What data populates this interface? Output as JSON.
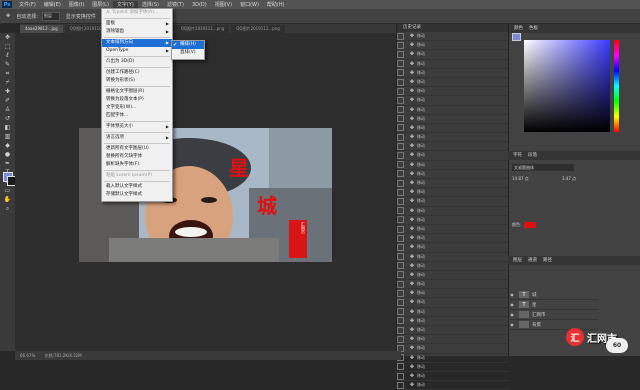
{
  "app": {
    "logo": "Ps"
  },
  "menubar": {
    "items": [
      "文件(F)",
      "编辑(E)",
      "图像(I)",
      "图层(L)",
      "文字(Y)",
      "选择(S)",
      "滤镜(T)",
      "3D(D)",
      "视图(V)",
      "窗口(W)",
      "帮助(H)"
    ],
    "active_index": 4
  },
  "options": {
    "auto_select_label": "自动选择:",
    "auto_select_value": "图层",
    "transform_label": "显示变换控件"
  },
  "tabs": [
    "4aae29812...jpg",
    "QQ图片2019110...png",
    "QQ图片2019112...png",
    "QQ图片2019111...png",
    "QQ图片2019112...png"
  ],
  "type_menu": {
    "items": [
      {
        "label": "从 Typekit 添加字体(A)...",
        "type": "disabled"
      },
      {
        "label": "面板",
        "type": "submenu"
      },
      {
        "label": "消除锯齿",
        "type": "submenu"
      },
      {
        "label": "文本排列方向",
        "type": "highlight"
      },
      {
        "label": "OpenType",
        "type": "submenu"
      },
      {
        "label": "凸出为 3D(D)",
        "type": "normal"
      },
      {
        "label": "创建工作路径(C)",
        "type": "normal"
      },
      {
        "label": "转换为形状(S)",
        "type": "normal"
      },
      {
        "label": "栅格化文字图层(R)",
        "type": "normal"
      },
      {
        "label": "转换为段落文本(P)",
        "type": "normal"
      },
      {
        "label": "文字变形(W)...",
        "type": "normal"
      },
      {
        "label": "匹配字体...",
        "type": "normal"
      },
      {
        "label": "字体预览大小",
        "type": "submenu"
      },
      {
        "label": "语言选项",
        "type": "submenu"
      },
      {
        "label": "更新所有文字图层(U)",
        "type": "normal"
      },
      {
        "label": "替换所有欠缺字体",
        "type": "normal"
      },
      {
        "label": "解析缺失字体(F)",
        "type": "normal"
      },
      {
        "label": "粘贴 Lorem Ipsum(P)",
        "type": "disabled"
      },
      {
        "label": "载入默认文字样式",
        "type": "normal"
      },
      {
        "label": "存储默认文字样式",
        "type": "normal"
      }
    ]
  },
  "submenu": {
    "items": [
      "横排(H)",
      "直排(V)"
    ],
    "checked_index": 0
  },
  "history": {
    "title": "历史记录",
    "item_label": "移动",
    "count": 39
  },
  "right": {
    "color_tabs": [
      "颜色",
      "色板"
    ],
    "char_tabs": [
      "字符",
      "段落"
    ],
    "char": {
      "font": "文叔题曲体",
      "size": "14.87 点",
      "leading": "3.47 点",
      "label_color": "颜色:"
    },
    "layer_tabs": [
      "图层",
      "通道",
      "路径"
    ],
    "layers": [
      {
        "name": "城",
        "type": "T"
      },
      {
        "name": "星",
        "type": "T"
      },
      {
        "name": "汇网市",
        "type": "img"
      },
      {
        "name": "背景",
        "type": "img"
      }
    ]
  },
  "status": {
    "zoom": "66.67%",
    "doc": "文档:781.2K/4.32M"
  },
  "watermark": {
    "logo_char": "汇",
    "text": "汇网市",
    "badge": "60"
  },
  "photo": {
    "vertical_text_1": "星",
    "vertical_text_2": "城",
    "seal": "汇网市"
  }
}
